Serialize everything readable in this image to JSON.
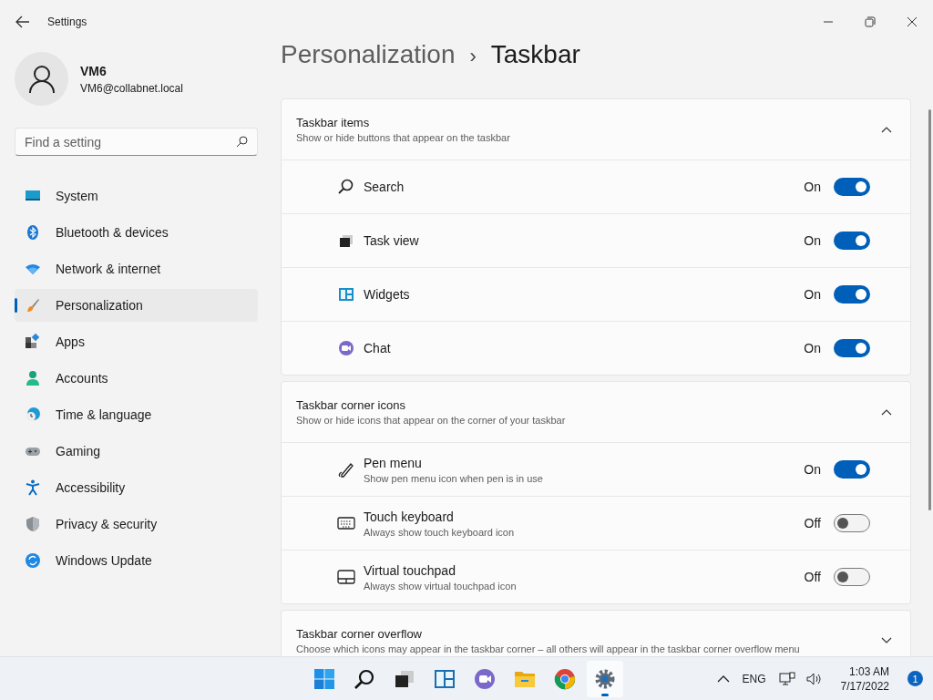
{
  "window": {
    "title": "Settings"
  },
  "profile": {
    "name": "VM6",
    "email": "VM6@collabnet.local"
  },
  "search": {
    "placeholder": "Find a setting"
  },
  "nav": [
    {
      "label": "System",
      "selected": false
    },
    {
      "label": "Bluetooth & devices",
      "selected": false
    },
    {
      "label": "Network & internet",
      "selected": false
    },
    {
      "label": "Personalization",
      "selected": true
    },
    {
      "label": "Apps",
      "selected": false
    },
    {
      "label": "Accounts",
      "selected": false
    },
    {
      "label": "Time & language",
      "selected": false
    },
    {
      "label": "Gaming",
      "selected": false
    },
    {
      "label": "Accessibility",
      "selected": false
    },
    {
      "label": "Privacy & security",
      "selected": false
    },
    {
      "label": "Windows Update",
      "selected": false
    }
  ],
  "breadcrumb": {
    "parent": "Personalization",
    "separator": "›",
    "current": "Taskbar"
  },
  "sections": [
    {
      "title": "Taskbar items",
      "description": "Show or hide buttons that appear on the taskbar",
      "expanded": true,
      "items": [
        {
          "label": "Search",
          "on": true,
          "state": "On"
        },
        {
          "label": "Task view",
          "on": true,
          "state": "On"
        },
        {
          "label": "Widgets",
          "on": true,
          "state": "On"
        },
        {
          "label": "Chat",
          "on": true,
          "state": "On"
        }
      ]
    },
    {
      "title": "Taskbar corner icons",
      "description": "Show or hide icons that appear on the corner of your taskbar",
      "expanded": true,
      "items": [
        {
          "label": "Pen menu",
          "description": "Show pen menu icon when pen is in use",
          "on": true,
          "state": "On"
        },
        {
          "label": "Touch keyboard",
          "description": "Always show touch keyboard icon",
          "on": false,
          "state": "Off"
        },
        {
          "label": "Virtual touchpad",
          "description": "Always show virtual touchpad icon",
          "on": false,
          "state": "Off"
        }
      ]
    },
    {
      "title": "Taskbar corner overflow",
      "description": "Choose which icons may appear in the taskbar corner – all others will appear in the taskbar corner overflow menu",
      "expanded": false
    }
  ],
  "taskbar": {
    "apps": [
      {
        "selected": false
      },
      {
        "selected": false
      },
      {
        "selected": false
      },
      {
        "selected": false
      },
      {
        "selected": false
      },
      {
        "selected": false
      },
      {
        "selected": false
      },
      {
        "selected": true
      }
    ],
    "language": "ENG",
    "time": "1:03 AM",
    "date": "7/17/2022",
    "notifications": "1"
  }
}
